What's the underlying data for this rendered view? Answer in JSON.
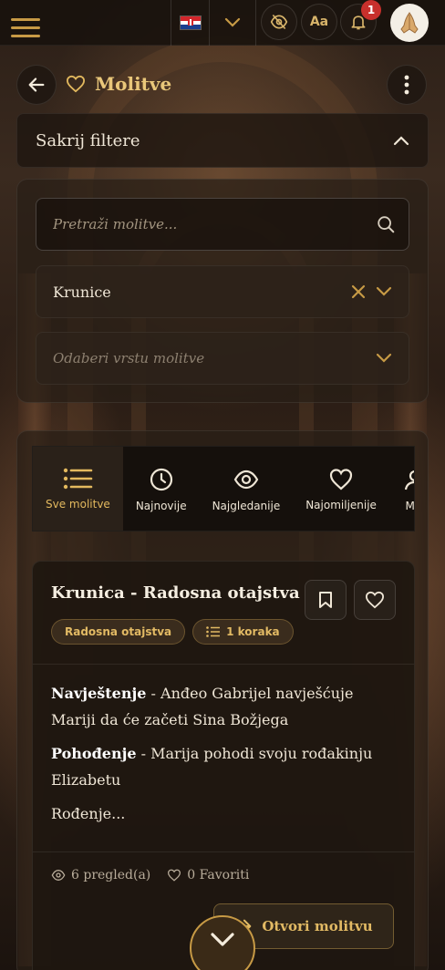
{
  "topbar": {
    "language_flag": "croatia-flag",
    "notification_count": "1",
    "font_size_label": "Aa",
    "colors": {
      "accent": "#c79a45",
      "badge": "#c8302c"
    }
  },
  "header": {
    "title": "Molitve"
  },
  "filters": {
    "toggle_label": "Sakrij filtere",
    "search_placeholder": "Pretraži molitve...",
    "category_value": "Krunice",
    "type_placeholder": "Odaberi vrstu molitve"
  },
  "tabs": [
    {
      "label": "Sve molitve",
      "icon": "list-icon",
      "active": true
    },
    {
      "label": "Najnovije",
      "icon": "clock-icon",
      "active": false
    },
    {
      "label": "Najgledanije",
      "icon": "eye-icon",
      "active": false
    },
    {
      "label": "Najomiljenije",
      "icon": "heart-icon",
      "active": false
    },
    {
      "label": "Moj",
      "icon": "user-icon",
      "active": false
    }
  ],
  "card": {
    "title": "Krunica - Radosna otajstva",
    "tags": [
      "Radosna otajstva",
      "1 koraka"
    ],
    "paragraphs": [
      {
        "bold": "Navještenje",
        "text": " - Anđeo Gabrijel navješćuje Mariji da će začeti Sina Božjega"
      },
      {
        "bold": "Pohođenje",
        "text": " - Marija pohodi svoju rođakinju Elizabetu"
      },
      {
        "bold": "",
        "text": "Rođenje..."
      }
    ],
    "views": "6 pregled(a)",
    "favorites": "0 Favoriti",
    "open_button": "Otvori molitvu"
  }
}
